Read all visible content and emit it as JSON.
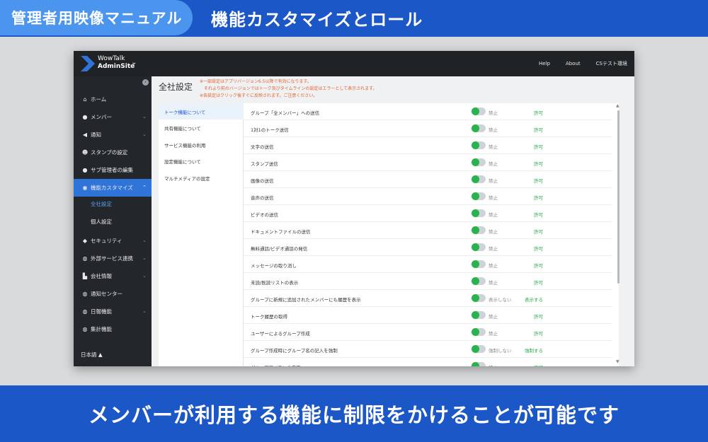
{
  "banner": {
    "tag": "管理者用映像マニュアル",
    "title": "機能カスタマイズとロール"
  },
  "caption": "メンバーが利用する機能に制限をかけることが可能です",
  "app": {
    "logo": {
      "line1": "WowTalk",
      "line2": "AdminSite"
    },
    "topnav": [
      "Help",
      "About",
      "CSテスト環境"
    ],
    "sidebar": {
      "items": [
        {
          "label": "ホーム",
          "icon": "home-icon",
          "glyph": "⌂",
          "chevron": false
        },
        {
          "label": "メンバー",
          "icon": "user-icon",
          "glyph": "●",
          "chevron": true
        },
        {
          "label": "通知",
          "icon": "megaphone-icon",
          "glyph": "◀",
          "chevron": true
        },
        {
          "label": "スタンプの設定",
          "icon": "smile-icon",
          "glyph": "☻",
          "chevron": false
        },
        {
          "label": "サブ管理者の編集",
          "icon": "user-admin-icon",
          "glyph": "●",
          "chevron": false
        },
        {
          "label": "機能カスタマイズ",
          "icon": "toggle-icon",
          "glyph": "◉",
          "chevron": true,
          "active": true
        },
        {
          "label": "セキュリティ",
          "icon": "shield-icon",
          "glyph": "◆",
          "chevron": true
        },
        {
          "label": "外部サービス連携",
          "icon": "link-icon",
          "glyph": "◍",
          "chevron": true
        },
        {
          "label": "会社情報",
          "icon": "building-icon",
          "glyph": "▙",
          "chevron": true
        },
        {
          "label": "通知センター",
          "icon": "globe-icon",
          "glyph": "◍",
          "chevron": false
        },
        {
          "label": "日報機能",
          "icon": "clipboard-icon",
          "glyph": "◍",
          "chevron": true
        },
        {
          "label": "集計機能",
          "icon": "chart-icon",
          "glyph": "◍",
          "chevron": false
        }
      ],
      "sub_items": [
        {
          "label": "全社設定",
          "current": true
        },
        {
          "label": "個人設定",
          "current": false
        }
      ],
      "language": "日本語 ▲"
    },
    "page_title": "全社設定",
    "notice": [
      "※一部設定はアプリバージョン6.5以降で有効になります。",
      "それより前のバージョンではトーク及びタイムラインの設定はエラーとして表示されます。",
      "※各設定はクリック後すぐに反映されます。ご注意ください。"
    ],
    "sub_nav": [
      {
        "label": "トーク機能について",
        "active": true
      },
      {
        "label": "共有機能について",
        "active": false
      },
      {
        "label": "サービス機能の利用",
        "active": false
      },
      {
        "label": "設定機能について",
        "active": false
      },
      {
        "label": "マルチメディアの設定",
        "active": false
      }
    ],
    "settings": [
      {
        "label": "グループ「全メンバー」への送信",
        "on": "許可",
        "off": "禁止",
        "enabled": true
      },
      {
        "label": "1対1のトーク送信",
        "on": "許可",
        "off": "禁止",
        "enabled": true
      },
      {
        "label": "文字の送信",
        "on": "許可",
        "off": "禁止",
        "enabled": true
      },
      {
        "label": "スタンプ送信",
        "on": "許可",
        "off": "禁止",
        "enabled": true
      },
      {
        "label": "画像の送信",
        "on": "許可",
        "off": "禁止",
        "enabled": true
      },
      {
        "label": "音声の送信",
        "on": "許可",
        "off": "禁止",
        "enabled": true
      },
      {
        "label": "ビデオの送信",
        "on": "許可",
        "off": "禁止",
        "enabled": true
      },
      {
        "label": "ドキュメントファイルの送信",
        "on": "許可",
        "off": "禁止",
        "enabled": true
      },
      {
        "label": "無料通話/ビデオ通話の発信",
        "on": "許可",
        "off": "禁止",
        "enabled": true
      },
      {
        "label": "メッセージの取り消し",
        "on": "許可",
        "off": "禁止",
        "enabled": true
      },
      {
        "label": "未読/既読リストの表示",
        "on": "許可",
        "off": "禁止",
        "enabled": true
      },
      {
        "label": "グループに新規に追加されたメンバーにも履歴を表示",
        "on": "表示する",
        "off": "表示しない",
        "enabled": true
      },
      {
        "label": "トーク履歴の取得",
        "on": "許可",
        "off": "禁止",
        "enabled": true
      },
      {
        "label": "ユーザーによるグループ作成",
        "on": "許可",
        "off": "禁止",
        "enabled": true
      },
      {
        "label": "グループ作成時にグループ名の記入を強制",
        "on": "強制する",
        "off": "強制しない",
        "enabled": true
      },
      {
        "label": "グループアイコンの変更",
        "on": "許可",
        "off": "禁止",
        "enabled": true
      }
    ],
    "colors": {
      "accent": "#1c57c8",
      "toggle_on": "#28b34b",
      "notice": "#e2632c"
    }
  }
}
